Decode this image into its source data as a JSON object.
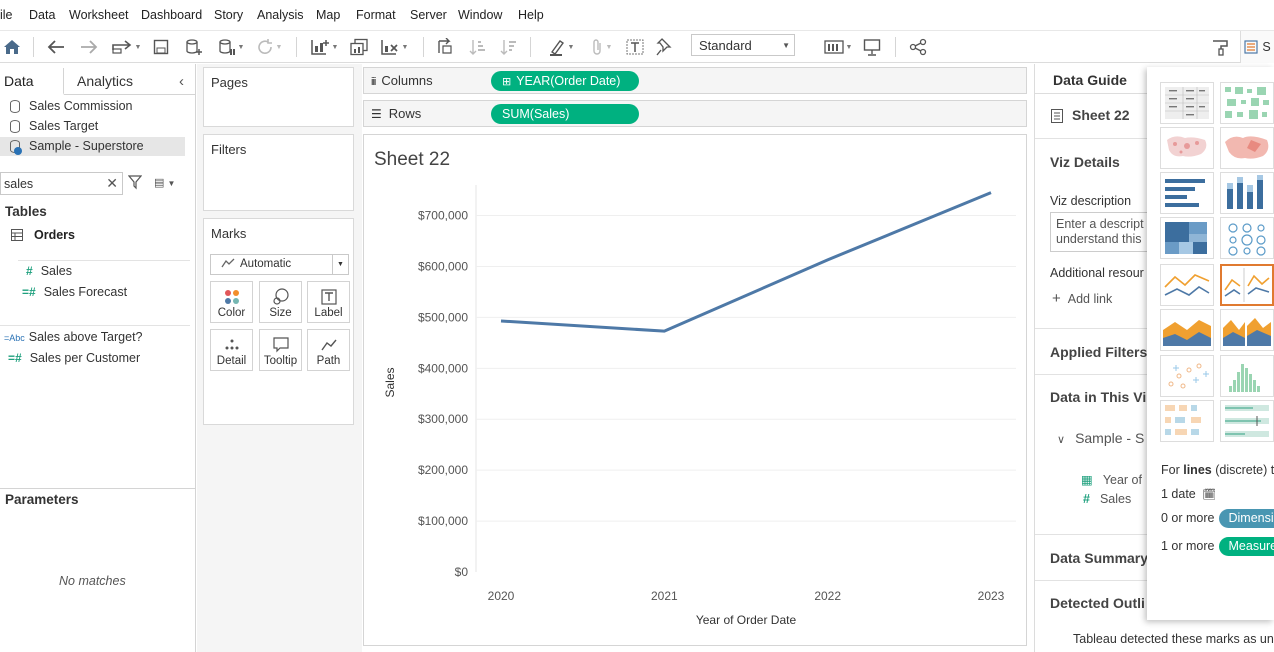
{
  "menu": [
    "ile",
    "Data",
    "Worksheet",
    "Dashboard",
    "Story",
    "Analysis",
    "Map",
    "Format",
    "Server",
    "Window",
    "Help"
  ],
  "toolbar": {
    "fit": "Standard",
    "right_label": "S"
  },
  "left": {
    "tab_data": "Data",
    "tab_analytics": "Analytics",
    "datasources": [
      "Sales Commission",
      "Sales Target",
      "Sample - Superstore"
    ],
    "search_value": "sales",
    "tables_header": "Tables",
    "table_name": "Orders",
    "fields": [
      "Sales",
      "Sales Forecast"
    ],
    "calc_fields": [
      "Sales above Target?",
      "Sales per Customer"
    ],
    "calc_abc": "=Abc",
    "parameters_header": "Parameters",
    "no_matches": "No matches"
  },
  "cards": {
    "pages": "Pages",
    "filters": "Filters",
    "marks": "Marks",
    "mark_type": "Automatic",
    "mark_buttons": [
      "Color",
      "Size",
      "Label",
      "Detail",
      "Tooltip",
      "Path"
    ]
  },
  "shelves": {
    "columns_label": "Columns",
    "rows_label": "Rows",
    "columns_pill": "YEAR(Order Date)",
    "rows_pill": "SUM(Sales)"
  },
  "sheet_title": "Sheet 22",
  "chart_data": {
    "type": "line",
    "title": "Sheet 22",
    "xlabel": "Year of Order Date",
    "ylabel": "Sales",
    "categories": [
      "2020",
      "2021",
      "2022",
      "2023"
    ],
    "series": [
      {
        "values": [
          493000,
          473000,
          613000,
          745000
        ]
      }
    ],
    "ylim": [
      0,
      760000
    ],
    "yticks": [
      0,
      100000,
      200000,
      300000,
      400000,
      500000,
      600000,
      700000
    ],
    "ytick_labels": [
      "$0",
      "$100,000",
      "$200,000",
      "$300,000",
      "$400,000",
      "$500,000",
      "$600,000",
      "$700,000"
    ],
    "line_color": "#4e79a7",
    "grid": true
  },
  "guide": {
    "title": "Data Guide",
    "sheet": "Sheet 22",
    "viz_details": "Viz Details",
    "viz_description": "Viz description",
    "desc_line1": "Enter a descript",
    "desc_line2": "understand this",
    "additional": "Additional resour",
    "add_link": "Add link",
    "applied_filters": "Applied Filters",
    "data_in_viz": "Data in This Vi",
    "source": "Sample - S",
    "field1": "Year of",
    "field2": "Sales",
    "data_summary": "Data Summary",
    "detected": "Detected Outli",
    "footer": "Tableau detected these marks as un"
  },
  "showme": {
    "line1_pre": "For ",
    "line1_bold": "lines",
    "line1_post": " (discrete) t",
    "line2": "1 date",
    "line3": "0 or more",
    "line3_badge": "Dimensi",
    "line4": "1 or more",
    "line4_badge": "Measure"
  },
  "colors": {
    "accent_green": "#00b180",
    "line_blue": "#4e79a7",
    "dimension_blue": "#4996b2",
    "selection_orange": "#e07a30"
  }
}
